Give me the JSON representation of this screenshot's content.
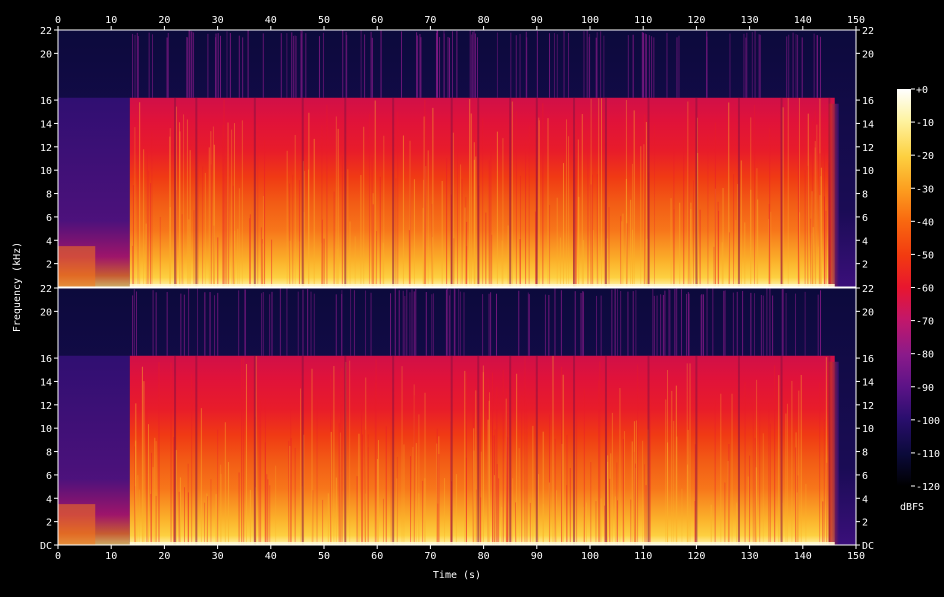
{
  "chart_data": {
    "type": "heatmap",
    "title": "",
    "xlabel": "Time (s)",
    "ylabel": "Frequency (kHz)",
    "xlim": [
      0,
      150
    ],
    "ylim_khz": [
      0,
      22
    ],
    "x_ticks": [
      0,
      10,
      20,
      30,
      40,
      50,
      60,
      70,
      80,
      90,
      100,
      110,
      120,
      130,
      140,
      150
    ],
    "y_ticks_top": [
      "2",
      "4",
      "6",
      "8",
      "10",
      "12",
      "14",
      "16",
      "20",
      "22"
    ],
    "y_ticks_bottom": [
      "DC",
      "2",
      "4",
      "6",
      "8",
      "10",
      "12",
      "14",
      "16",
      "20",
      "22"
    ],
    "channels": 2,
    "colorbar": {
      "label": "dBFS",
      "ticks": [
        "+0",
        "-10",
        "-20",
        "-30",
        "-40",
        "-50",
        "-60",
        "-70",
        "-80",
        "-90",
        "-100",
        "-110",
        "-120"
      ],
      "range_db": [
        -120,
        0
      ],
      "colors": [
        "#000000",
        "#0b0a3a",
        "#2a0e6e",
        "#5c1387",
        "#8a1a8a",
        "#c3176a",
        "#e8162f",
        "#f23a10",
        "#f96a10",
        "#fca020",
        "#fdd040",
        "#fef3a0",
        "#ffffff"
      ]
    },
    "audio_segment_s": [
      0,
      146
    ],
    "cutoff_khz": 16.2,
    "intro_cutoff_khz": 3.5,
    "quiet_gaps_s": [
      13.5,
      22,
      26,
      37,
      46,
      54,
      63,
      74,
      79,
      85,
      90,
      97,
      103,
      111,
      120,
      128,
      136,
      145
    ]
  }
}
